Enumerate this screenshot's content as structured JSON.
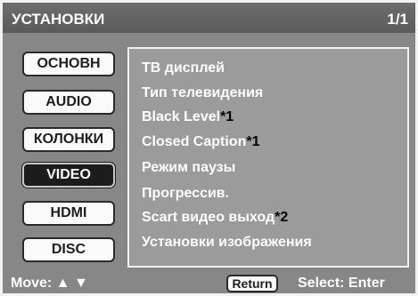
{
  "header": {
    "title": "УСТАНОВКИ",
    "page": "1/1"
  },
  "menu": {
    "items": [
      {
        "label": "ОСНОВН"
      },
      {
        "label": "AUDIO"
      },
      {
        "label": "КОЛОНКИ"
      },
      {
        "label": "VIDEO"
      },
      {
        "label": "HDMI"
      },
      {
        "label": "DISC"
      }
    ],
    "selected": "VIDEO"
  },
  "panel": {
    "items": [
      {
        "label": "ТВ дисплей",
        "note": ""
      },
      {
        "label": "Тип телевидения",
        "note": ""
      },
      {
        "label": "Black Level",
        "note": "*1"
      },
      {
        "label": "Closed Caption",
        "note": "*1"
      },
      {
        "label": "Режим паузы",
        "note": ""
      },
      {
        "label": "Прогрессив.",
        "note": ""
      },
      {
        "label": "Scart видео выход",
        "note": "*2"
      },
      {
        "label": "Установки изображения",
        "note": ""
      }
    ]
  },
  "footer": {
    "move_label": "Move: ▲ ▼",
    "return_label": "Return",
    "select_label": "Select: Enter"
  },
  "colors": {
    "background": "#878787",
    "panel": "#9b9b9b",
    "selected_button": "#1c1c1c",
    "title_bar": "#626262"
  }
}
